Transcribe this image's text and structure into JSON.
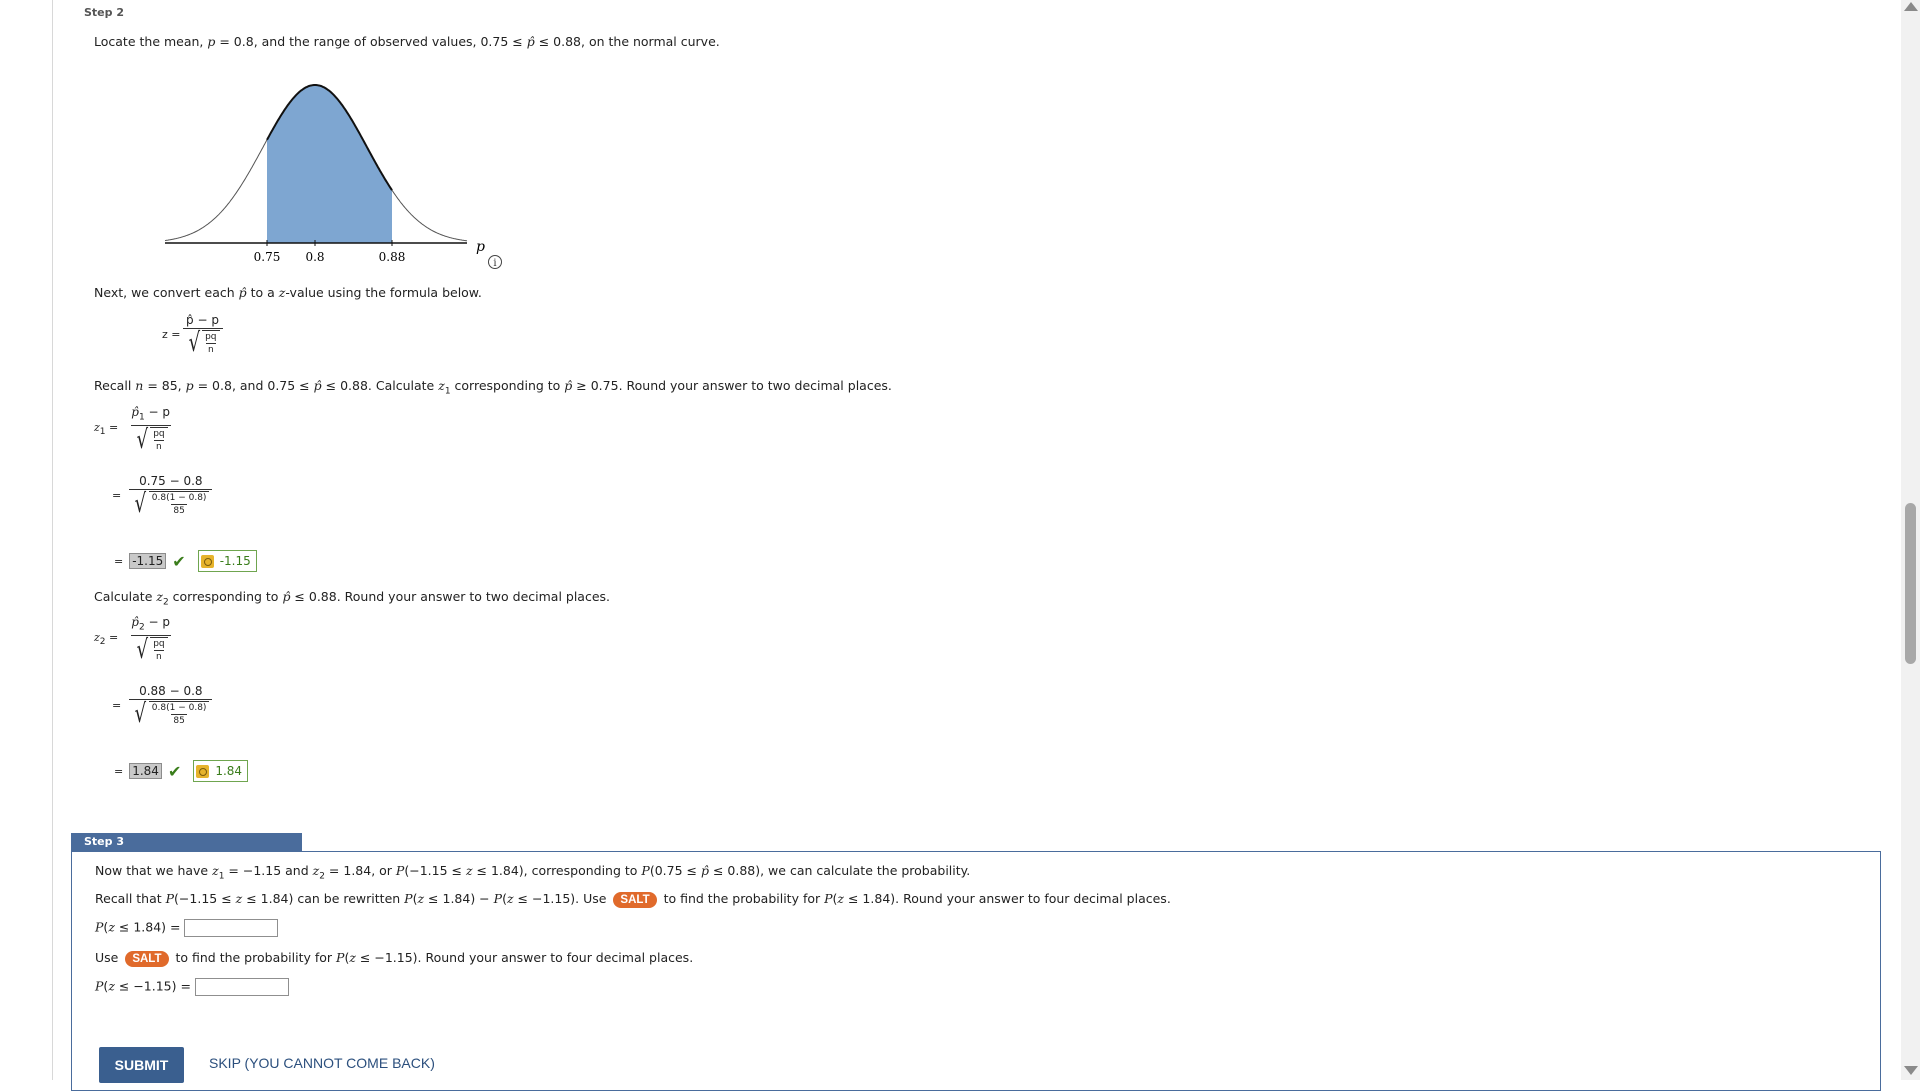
{
  "step2": {
    "label": "Step 2",
    "intro_a": "Locate the mean, ",
    "intro_p": "p",
    "intro_b": " = 0.8, and the range of observed values, 0.75 ≤ ",
    "intro_phat": "p̂",
    "intro_c": " ≤ 0.88, on the normal curve.",
    "chart": {
      "tick_labels": [
        "0.75",
        "0.8",
        "0.88"
      ],
      "axis_label": "p",
      "info_icon": "info-icon"
    },
    "next_a": "Next, we convert each ",
    "next_phat": "p̂",
    "next_b": " to a ",
    "next_z": "z",
    "next_c": "-value using the formula below.",
    "formula": {
      "lhs": "z =",
      "num": "p̂ − p",
      "inner": "pq",
      "inner_den": "n"
    },
    "recall_a": "Recall ",
    "recall_n": "n",
    "recall_b": " = 85, ",
    "recall_p": "p",
    "recall_c": " = 0.8, and 0.75 ≤ ",
    "recall_phat": "p̂",
    "recall_d": " ≤ 0.88. Calculate ",
    "recall_z": "z",
    "recall_sub": "1",
    "recall_e": " corresponding to ",
    "recall_phat2": "p̂",
    "recall_f": " ≥ 0.75. Round your answer to two decimal places.",
    "z1": {
      "lhs": "z",
      "sub": "1",
      "eq": "=",
      "num": "p̂",
      "num_sub": "1",
      "num_tail": " − p",
      "inner": "pq",
      "inner_den": "n",
      "num2": "0.75 − 0.8",
      "inner2": "0.8(1 − 0.8)",
      "inner2_den": "85",
      "answer": "-1.15",
      "key": "-1.15"
    },
    "calc2_a": "Calculate ",
    "calc2_z": "z",
    "calc2_sub": "2",
    "calc2_b": " corresponding to ",
    "calc2_phat": "p̂",
    "calc2_c": " ≤ 0.88. Round your answer to two decimal places.",
    "z2": {
      "lhs": "z",
      "sub": "2",
      "eq": "=",
      "num": "p̂",
      "num_sub": "2",
      "num_tail": " − p",
      "inner": "pq",
      "inner_den": "n",
      "num2": "0.88 − 0.8",
      "inner2": "0.8(1 − 0.8)",
      "inner2_den": "85",
      "answer": "1.84",
      "key": "1.84"
    }
  },
  "step3": {
    "label": "Step 3",
    "now_a": "Now that we have ",
    "now_z1": "z",
    "now_sub1": "1",
    "now_b": " = −1.15 and ",
    "now_z2": "z",
    "now_sub2": "2",
    "now_c": " = 1.84, or ",
    "now_P": "P",
    "now_d": "(−1.15 ≤ ",
    "now_z3": "z",
    "now_e": " ≤ 1.84), corresponding to ",
    "now_P2": "P",
    "now_f": "(0.75 ≤ ",
    "now_phat": "p̂",
    "now_g": " ≤ 0.88), we can calculate the probability.",
    "recall_a": "Recall that ",
    "recall_P": "P",
    "recall_b": "(−1.15 ≤ ",
    "recall_z": "z",
    "recall_c": " ≤ 1.84) can be rewritten ",
    "recall_P2": "P",
    "recall_d": "(",
    "recall_z2": "z",
    "recall_e": " ≤ 1.84) − ",
    "recall_P3": "P",
    "recall_f": "(",
    "recall_z3": "z",
    "recall_g": " ≤ −1.15). Use ",
    "salt": "SALT",
    "recall_h": " to find the probability for ",
    "recall_P4": "P",
    "recall_i": "(",
    "recall_z4": "z",
    "recall_j": " ≤ 1.84). Round your answer to four decimal places.",
    "input1_P": "P",
    "input1_a": "(",
    "input1_z": "z",
    "input1_b": " ≤ 1.84) =",
    "input1_value": "",
    "use_a": "Use ",
    "use_b": " to find the probability for ",
    "use_P": "P",
    "use_c": "(",
    "use_z": "z",
    "use_d": " ≤ −1.15). Round your answer to four decimal places.",
    "input2_P": "P",
    "input2_a": "(",
    "input2_z": "z",
    "input2_b": " ≤ −1.15) =",
    "input2_value": ""
  },
  "actions": {
    "submit": "SUBMIT",
    "skip": "SKIP (YOU CANNOT COME BACK)"
  },
  "colors": {
    "accent": "#4a6c9c",
    "salt": "#e06a2b",
    "curve_fill": "#7ea6d1",
    "check": "#3a7d1b"
  }
}
